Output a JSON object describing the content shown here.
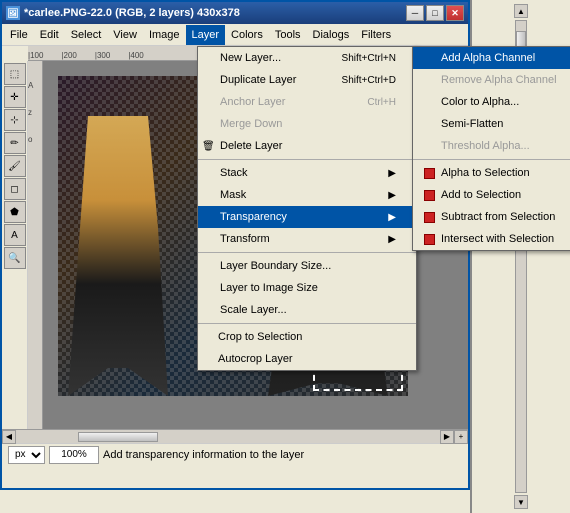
{
  "window": {
    "title": "*carlee.PNG-22.0 (RGB, 2 layers) 430x378",
    "titlebar_icon": "🖼"
  },
  "titlebar_buttons": {
    "minimize": "─",
    "maximize": "□",
    "close": "✕"
  },
  "menubar": {
    "items": [
      {
        "id": "file",
        "label": "File"
      },
      {
        "id": "edit",
        "label": "Edit"
      },
      {
        "id": "select",
        "label": "Select"
      },
      {
        "id": "view",
        "label": "View"
      },
      {
        "id": "image",
        "label": "Image"
      },
      {
        "id": "layer",
        "label": "Layer"
      },
      {
        "id": "colors",
        "label": "Colors"
      },
      {
        "id": "tools",
        "label": "Tools"
      },
      {
        "id": "dialogs",
        "label": "Dialogs"
      },
      {
        "id": "filters",
        "label": "Filters"
      }
    ]
  },
  "ruler": {
    "ticks": [
      "100",
      "200",
      "300",
      "400"
    ]
  },
  "layer_menu": {
    "items": [
      {
        "id": "new-layer",
        "label": "New Layer...",
        "shortcut": "Shift+Ctrl+N",
        "icon": ""
      },
      {
        "id": "duplicate-layer",
        "label": "Duplicate Layer",
        "shortcut": "Shift+Ctrl+D",
        "icon": ""
      },
      {
        "id": "anchor-layer",
        "label": "Anchor Layer",
        "shortcut": "Ctrl+H",
        "icon": "",
        "disabled": true
      },
      {
        "id": "merge-down",
        "label": "Merge Down",
        "shortcut": "",
        "icon": "",
        "disabled": true
      },
      {
        "id": "delete-layer",
        "label": "Delete Layer",
        "shortcut": "",
        "icon": "🗑"
      },
      {
        "id": "sep1",
        "type": "separator"
      },
      {
        "id": "stack",
        "label": "Stack",
        "arrow": "▶"
      },
      {
        "id": "mask",
        "label": "Mask",
        "arrow": "▶"
      },
      {
        "id": "transparency",
        "label": "Transparency",
        "arrow": "▶",
        "active": true
      },
      {
        "id": "transform",
        "label": "Transform",
        "arrow": "▶"
      },
      {
        "id": "sep2",
        "type": "separator"
      },
      {
        "id": "layer-boundary",
        "label": "Layer Boundary Size...",
        "icon": ""
      },
      {
        "id": "layer-to-image",
        "label": "Layer to Image Size",
        "icon": ""
      },
      {
        "id": "scale-layer",
        "label": "Scale Layer...",
        "icon": ""
      },
      {
        "id": "sep3",
        "type": "separator"
      },
      {
        "id": "crop-to-selection",
        "label": "Crop to Selection"
      },
      {
        "id": "autocrop-layer",
        "label": "Autocrop Layer"
      }
    ]
  },
  "transparency_submenu": {
    "items": [
      {
        "id": "add-alpha-channel",
        "label": "Add Alpha Channel",
        "active": true,
        "icon": "none"
      },
      {
        "id": "remove-alpha-channel",
        "label": "Remove Alpha Channel",
        "disabled": true,
        "icon": "none"
      },
      {
        "id": "color-to-alpha",
        "label": "Color to Alpha...",
        "icon": "none"
      },
      {
        "id": "semi-flatten",
        "label": "Semi-Flatten",
        "icon": "none"
      },
      {
        "id": "threshold-alpha",
        "label": "Threshold Alpha...",
        "disabled": true,
        "icon": "none"
      },
      {
        "id": "sep",
        "type": "separator"
      },
      {
        "id": "alpha-to-selection",
        "label": "Alpha to Selection",
        "icon": "red"
      },
      {
        "id": "add-to-selection",
        "label": "Add to Selection",
        "icon": "red"
      },
      {
        "id": "subtract-from-selection",
        "label": "Subtract from Selection",
        "icon": "red"
      },
      {
        "id": "intersect-with-selection",
        "label": "Intersect with Selection",
        "icon": "red"
      }
    ]
  },
  "statusbar": {
    "unit": "px",
    "zoom": "100%",
    "status_text": "Add transparency information to the layer"
  },
  "right_panel": {
    "scroll_indicator": "▲"
  }
}
